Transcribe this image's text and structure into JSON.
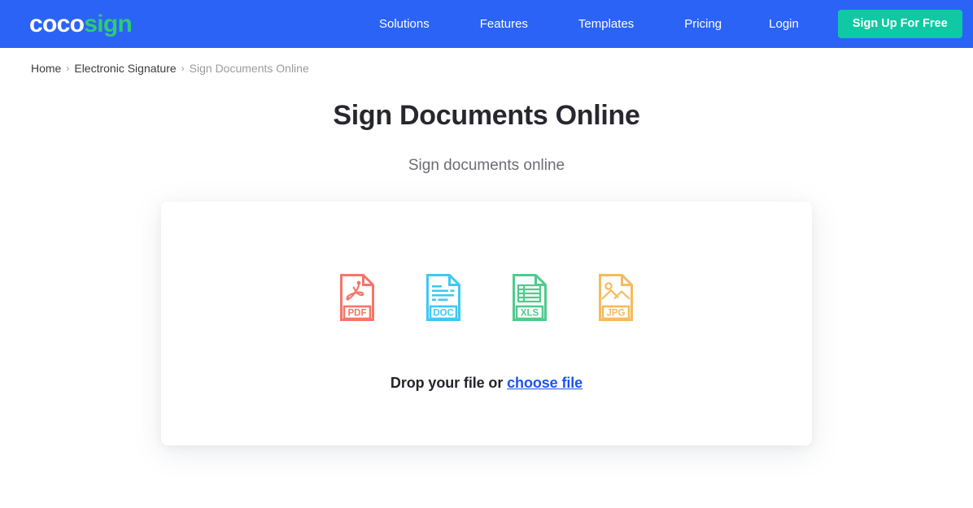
{
  "header": {
    "logo": {
      "part1": "coco",
      "part2": "sign",
      "color1": "#ffffff",
      "color2": "#2ecb74"
    },
    "background_color": "#2a63f6",
    "nav_items": [
      {
        "label": "Solutions",
        "name": "nav-solutions"
      },
      {
        "label": "Features",
        "name": "nav-features"
      },
      {
        "label": "Templates",
        "name": "nav-templates"
      },
      {
        "label": "Pricing",
        "name": "nav-pricing"
      },
      {
        "label": "Login",
        "name": "nav-login"
      }
    ],
    "signup_button": {
      "label": "Sign Up For Free",
      "color": "#0ec9a3"
    }
  },
  "breadcrumb": {
    "items": [
      {
        "label": "Home",
        "current": false
      },
      {
        "label": "Electronic Signature",
        "current": false
      },
      {
        "label": "Sign Documents Online",
        "current": true
      }
    ],
    "separator": "›"
  },
  "hero": {
    "title": "Sign Documents Online",
    "subtitle": "Sign documents online"
  },
  "drop_card": {
    "file_types": [
      {
        "label": "PDF",
        "icon": "pdf-file-icon",
        "color": "#f4766a"
      },
      {
        "label": "DOC",
        "icon": "doc-file-icon",
        "color": "#3fc8f4"
      },
      {
        "label": "XLS",
        "icon": "xls-file-icon",
        "color": "#4ecb8d"
      },
      {
        "label": "JPG",
        "icon": "jpg-file-icon",
        "color": "#f5bb5c"
      }
    ],
    "drop_prefix": "Drop your file or ",
    "choose_file_label": "choose file",
    "choose_file_color": "#1a54f0"
  }
}
